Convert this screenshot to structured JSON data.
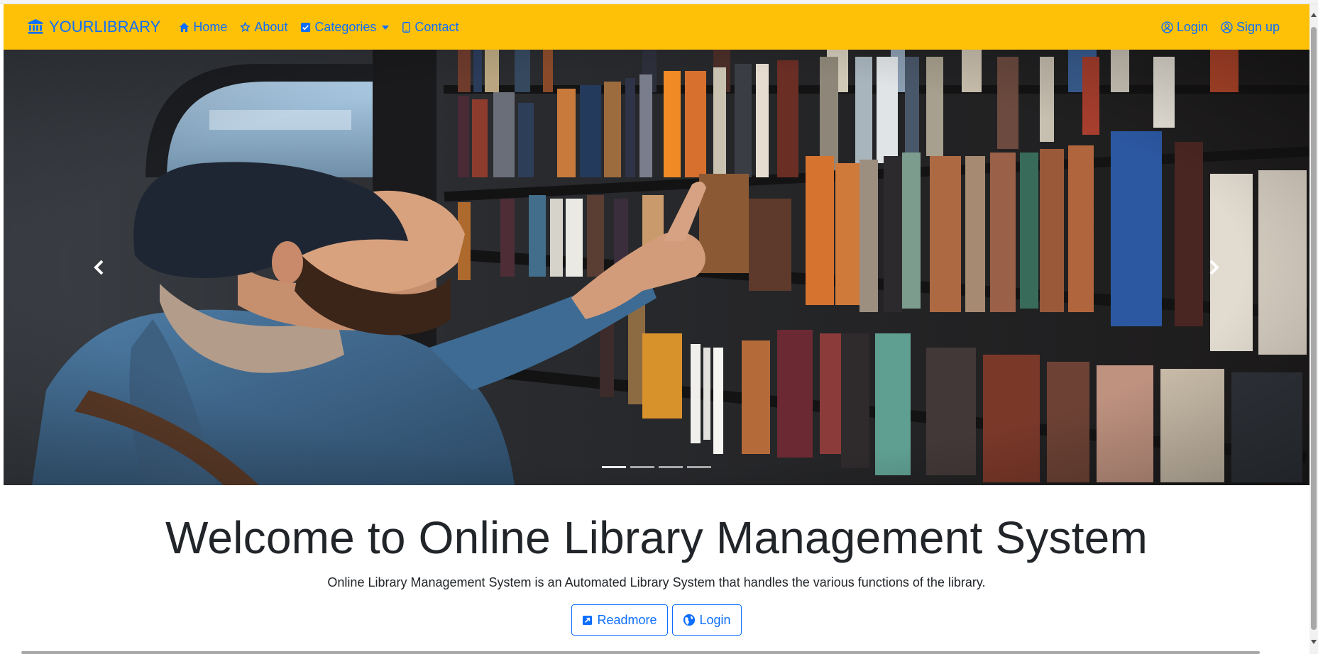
{
  "navbar": {
    "brand": "YOURLIBRARY",
    "brand_icon": "bank-icon",
    "items": [
      {
        "label": "Home",
        "icon": "house-icon"
      },
      {
        "label": "About",
        "icon": "star-icon"
      },
      {
        "label": "Categories",
        "icon": "check-square-icon"
      },
      {
        "label": "Contact",
        "icon": "phone-icon"
      }
    ],
    "right_items": [
      {
        "label": "Login",
        "icon": "person-circle-icon"
      },
      {
        "label": "Sign up",
        "icon": "person-circle-icon"
      }
    ],
    "background": "#ffc107",
    "link_color": "#0d6efd"
  },
  "carousel": {
    "indicator_count": 4,
    "prev_icon": "chevron-left-icon",
    "next_icon": "chevron-right-icon"
  },
  "hero": {
    "title": "Welcome to Online Library Management System",
    "subtitle": "Online Library Management System is an Automated Library System that handles the various functions of the library.",
    "buttons": [
      {
        "label": "Readmore",
        "icon": "box-arrow-up-right-icon"
      },
      {
        "label": "Login",
        "icon": "globe-icon"
      }
    ]
  }
}
